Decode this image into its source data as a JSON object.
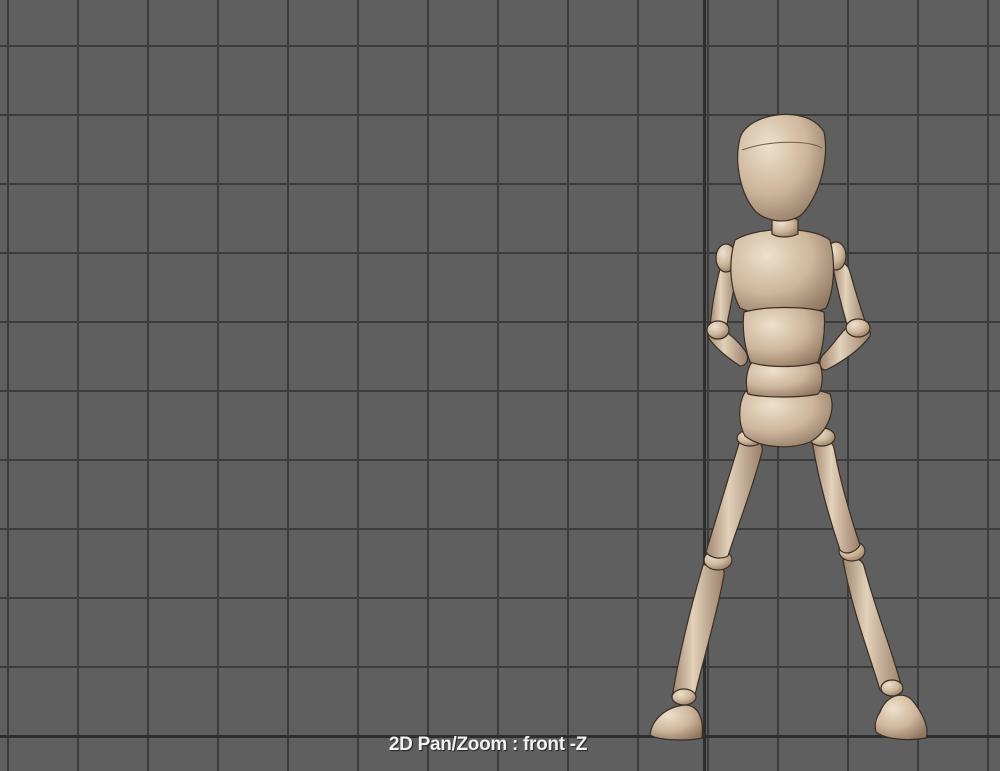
{
  "viewport": {
    "name": "front-view",
    "label": "2D Pan/Zoom : front -Z",
    "colors": {
      "background": "#5f5f5f",
      "grid": "#3c3c3c",
      "axis": "#2e2e2e",
      "figure_fill": "#c9b298",
      "figure_highlight": "#e6d5bf",
      "figure_shadow": "#8e7560",
      "label": "#f2f2f2"
    }
  }
}
